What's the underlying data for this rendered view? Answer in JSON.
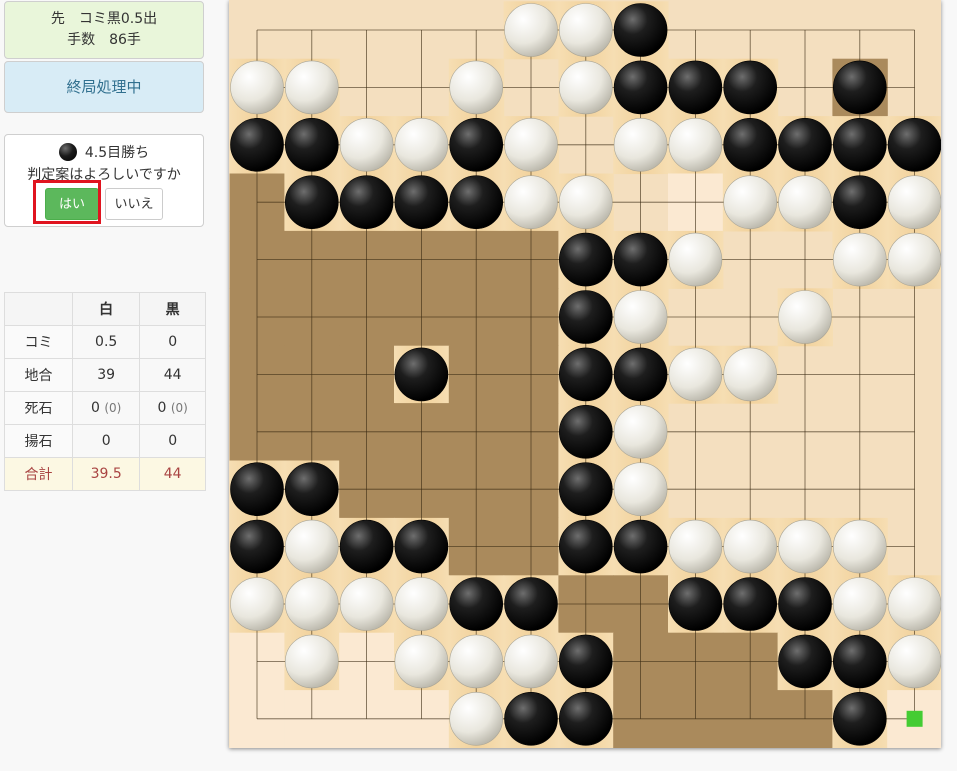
{
  "game_info": {
    "line1": "先　コミ黒0.5出",
    "line2": "手数　86手"
  },
  "status": "終局処理中",
  "result": {
    "winner_color": "black",
    "text": "4.5目勝ち",
    "question": "判定案はよろしいですか",
    "yes_label": "はい",
    "no_label": "いいえ"
  },
  "score_table": {
    "headers": [
      "",
      "白",
      "黒"
    ],
    "rows": [
      {
        "label": "コミ",
        "white": "0.5",
        "black": "0"
      },
      {
        "label": "地合",
        "white": "39",
        "black": "44"
      },
      {
        "label": "死石",
        "white": "0",
        "white_sub": "(0)",
        "black": "0",
        "black_sub": "(0)"
      },
      {
        "label": "揚石",
        "white": "0",
        "black": "0"
      },
      {
        "label": "合計",
        "white": "39.5",
        "black": "44"
      }
    ]
  },
  "board": {
    "size": 13,
    "stones": [
      ".....WWB.....",
      "WW..W.WBBB.B.",
      "BBWWBW.WWBBBB",
      ".BBBBWW..WWBW",
      "......BBW..WW",
      "......BW..W..",
      "...B..BBWW...",
      "......BW.....",
      "BB....BW.....",
      "BWBB..BBWWWW.",
      "WWWWBB..BBBWW",
      ".W.WWWB...BBW",
      "....WBB....B."
    ],
    "territory": [
      ".............",
      "...........B.",
      ".............",
      "B.......W....",
      "BBBBBB.......",
      "BBBBBB.......",
      "BBB.BB.......",
      "BBBBBB.......",
      "..BBBB.......",
      "....BB.......",
      "......BB.....",
      "W.W....BBB...",
      "WWWW...BBBB.W"
    ],
    "last_move_marker": {
      "row": 12,
      "col": 12,
      "color": "#44cc33"
    }
  }
}
